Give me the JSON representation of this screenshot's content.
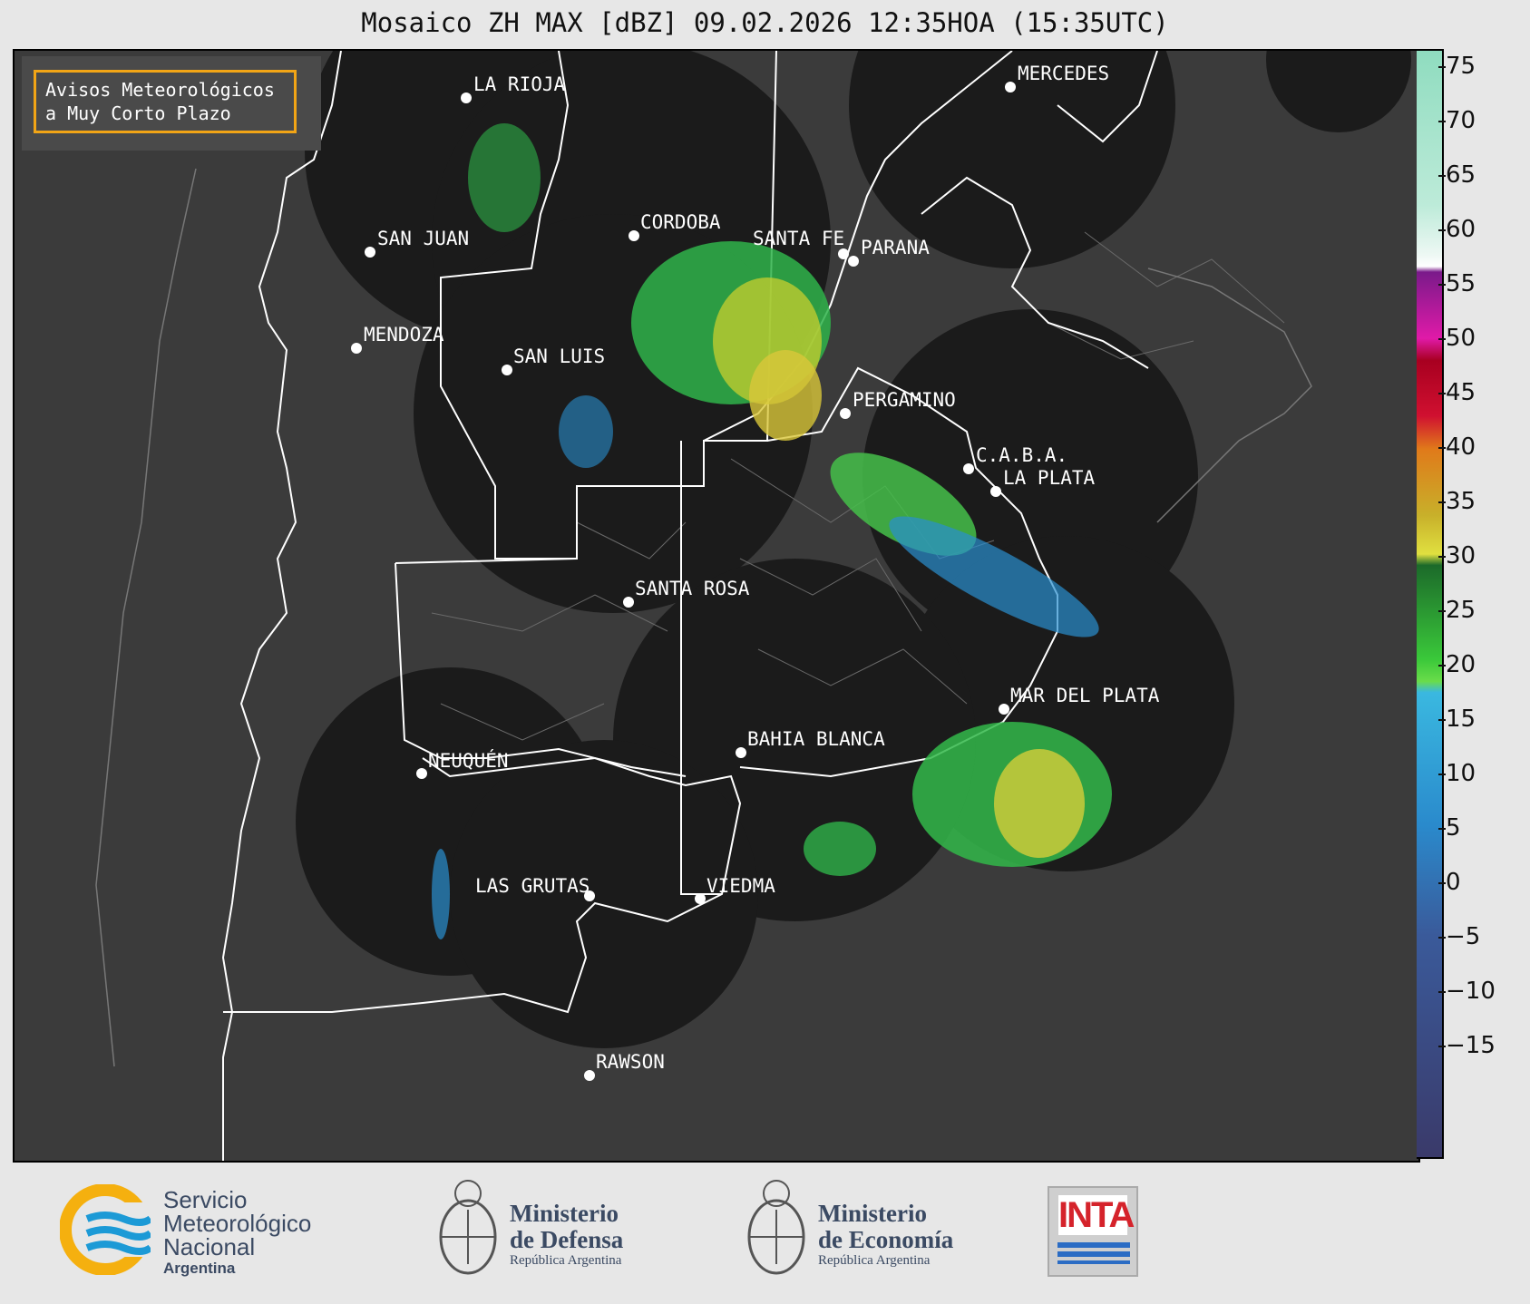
{
  "title": "Mosaico ZH MAX [dBZ] 09.02.2026 12:35HOA (15:35UTC)",
  "notice": {
    "line1": "Avisos Meteorológicos",
    "line2": "a Muy Corto Plazo",
    "border_color": "#f2a516"
  },
  "cities": [
    {
      "name": "LA RIOJA"
    },
    {
      "name": "MERCEDES"
    },
    {
      "name": "CORDOBA"
    },
    {
      "name": "SAN JUAN"
    },
    {
      "name": "SANTA FE"
    },
    {
      "name": "PARANA"
    },
    {
      "name": "MENDOZA"
    },
    {
      "name": "SAN LUIS"
    },
    {
      "name": "PERGAMINO"
    },
    {
      "name": "C.A.B.A."
    },
    {
      "name": "LA PLATA"
    },
    {
      "name": "SANTA ROSA"
    },
    {
      "name": "MAR DEL PLATA"
    },
    {
      "name": "BAHIA BLANCA"
    },
    {
      "name": "NEUQUÉN"
    },
    {
      "name": "LAS GRUTAS"
    },
    {
      "name": "VIEDMA"
    },
    {
      "name": "RAWSON"
    }
  ],
  "colorbar": {
    "unit": "dBZ",
    "range": [
      -19,
      77
    ],
    "ticks": [
      "75",
      "70",
      "65",
      "60",
      "55",
      "50",
      "45",
      "40",
      "35",
      "30",
      "25",
      "20",
      "15",
      "10",
      "5",
      "0",
      "−5",
      "−10",
      "−15"
    ]
  },
  "footer": {
    "smn": {
      "line1": "Servicio",
      "line2": "Meteorológico",
      "line3": "Nacional",
      "line4": "Argentina"
    },
    "defensa": {
      "line1": "Ministerio",
      "line2": "de Defensa",
      "line3": "República Argentina"
    },
    "economia": {
      "line1": "Ministerio",
      "line2": "de Economía",
      "line3": "República Argentina"
    },
    "inta": {
      "label": "INTA"
    }
  },
  "colors": {
    "land": "#3b3b3b",
    "coverage": "#1b1b1b",
    "boundary": "#ffffff",
    "accent": "#f2a516"
  }
}
